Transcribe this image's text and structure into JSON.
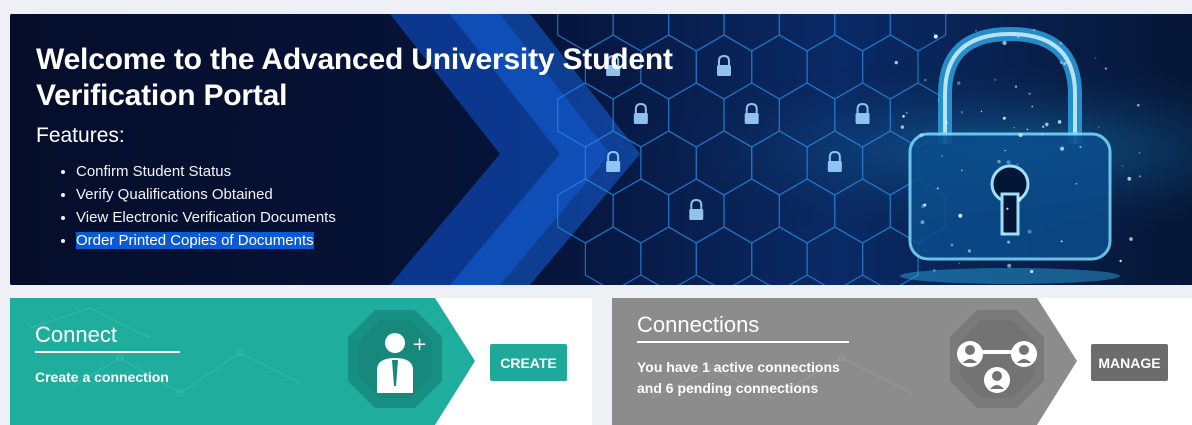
{
  "hero": {
    "title": "Welcome to the Advanced University Student Verification Portal",
    "features_heading": "Features:",
    "features": [
      "Confirm Student Status",
      "Verify Qualifications Obtained",
      "View Electronic Verification Documents",
      "Order Printed Copies of Documents"
    ]
  },
  "connect_card": {
    "title": "Connect",
    "description": "Create a connection",
    "button_label": "CREATE",
    "icon": "add-user-icon",
    "color": "#1fae9e"
  },
  "connections_card": {
    "title": "Connections",
    "line1_prefix": "You have ",
    "active_count": "1",
    "line1_suffix": " active connections",
    "line2_prefix": "and ",
    "pending_count": "6",
    "line2_suffix": " pending connections",
    "button_label": "MANAGE",
    "icon": "connections-icon",
    "color": "#8c8c8c"
  },
  "colors": {
    "hero_bg": "#050d2a",
    "accent_blue": "#1e6fd9",
    "teal": "#1fae9e",
    "gray": "#8c8c8c"
  }
}
